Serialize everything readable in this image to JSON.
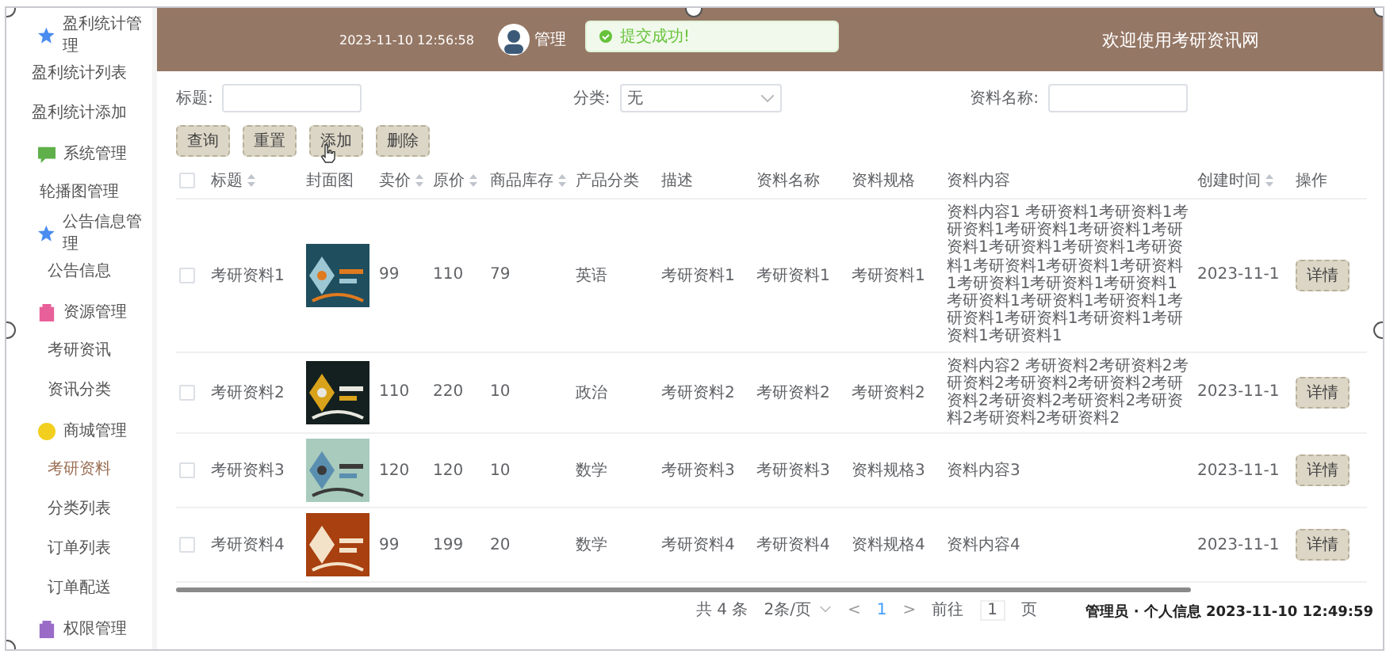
{
  "sidebar": {
    "groups": [
      {
        "label": "盈利统计管理",
        "color": "#4a8cf0",
        "children": [
          {
            "label": "盈利统计列表",
            "selected": false
          },
          {
            "label": "盈利统计添加",
            "selected": false
          }
        ]
      },
      {
        "label": "系统管理",
        "color": "#5fb04a",
        "children": [
          {
            "label": "轮播图管理",
            "selected": false
          }
        ]
      },
      {
        "label": "公告信息管理",
        "color": "#4a8cf0",
        "children": [
          {
            "label": "公告信息",
            "selected": false
          }
        ]
      },
      {
        "label": "资源管理",
        "color": "#e8609a",
        "children": [
          {
            "label": "考研资讯",
            "selected": false
          },
          {
            "label": "资讯分类",
            "selected": false
          }
        ]
      },
      {
        "label": "商城管理",
        "color": "#f2cf1e",
        "children": [
          {
            "label": "考研资料",
            "selected": true
          },
          {
            "label": "分类列表",
            "selected": false
          },
          {
            "label": "订单列表",
            "selected": false
          },
          {
            "label": "订单配送",
            "selected": false
          }
        ]
      },
      {
        "label": "权限管理",
        "color": "#9a6cc8"
      }
    ]
  },
  "header": {
    "datetime": "2023-11-10 12:56:58",
    "user": "管理",
    "title": "欢迎使用考研资讯网"
  },
  "toast": {
    "message": "提交成功!"
  },
  "search": {
    "fields": [
      {
        "label": "标题:",
        "kind": "input"
      },
      {
        "label": "分类:",
        "kind": "select",
        "value": "无"
      },
      {
        "label": "资料名称:",
        "kind": "input"
      }
    ],
    "buttons": [
      "查询",
      "重置",
      "添加",
      "删除"
    ]
  },
  "table": {
    "select_all_checked": false,
    "columns": [
      {
        "label": "标题",
        "sortable": true
      },
      {
        "label": "封面图",
        "sortable": false
      },
      {
        "label": "卖价",
        "sortable": true
      },
      {
        "label": "原价",
        "sortable": true
      },
      {
        "label": "商品库存",
        "sortable": true
      },
      {
        "label": "产品分类",
        "sortable": false
      },
      {
        "label": "描述",
        "sortable": false
      },
      {
        "label": "资料名称",
        "sortable": false
      },
      {
        "label": "资料规格",
        "sortable": false
      },
      {
        "label": "资料内容",
        "sortable": false
      },
      {
        "label": "创建时间",
        "sortable": true
      },
      {
        "label": "操作",
        "sortable": false
      }
    ],
    "rows": [
      {
        "checked": false,
        "cells": [
          "考研资料1",
          {
            "kind": "picture"
          },
          "99",
          "110",
          "79",
          "英语",
          "考研资料1",
          "考研资料1",
          "考研资料1",
          "资料内容1 考研资料1考研资料1考研资料1考研资料1考研资料1考研资料1考研资料1考研资料1考研资料1考研资料1考研资料1考研资料1考研资料1考研资料1考研资料1考研资料1考研资料1考研资料1考研资料1考研资料1考研资料1考研资料1考研资料1",
          "2023-11-1",
          {
            "kind": "button",
            "label": "详情"
          }
        ]
      },
      {
        "checked": false,
        "cells": [
          "考研资料2",
          {
            "kind": "picture"
          },
          "110",
          "220",
          "10",
          "政治",
          "考研资料2",
          "考研资料2",
          "考研资料2",
          "资料内容2 考研资料2考研资料2考研资料2考研资料2考研资料2考研资料2考研资料2考研资料2考研资料2考研资料2考研资料2",
          "2023-11-1",
          {
            "kind": "button",
            "label": "详情"
          }
        ]
      },
      {
        "checked": false,
        "cells": [
          "考研资料3",
          {
            "kind": "picture"
          },
          "120",
          "120",
          "10",
          "数学",
          "考研资料3",
          "考研资料3",
          "资料规格3",
          "资料内容3",
          "2023-11-1",
          {
            "kind": "button",
            "label": "详情"
          }
        ]
      },
      {
        "checked": false,
        "cells": [
          "考研资料4",
          {
            "kind": "picture"
          },
          "99",
          "199",
          "20",
          "数学",
          "考研资料4",
          "考研资料4",
          "资料规格4",
          "资料内容4",
          "2023-11-1",
          {
            "kind": "button",
            "label": "详情"
          }
        ]
      }
    ]
  },
  "pagination": {
    "total": "共 4 条",
    "page_size": "2条/页",
    "prev": "<",
    "pages": [
      {
        "label": "1",
        "selected": true
      }
    ],
    "next": ">",
    "goto_label": "前往",
    "goto_value": "1",
    "goto_suffix": "页"
  },
  "notification": {
    "text": "管理员 · 个人信息 2023-11-10 12:49:59"
  }
}
